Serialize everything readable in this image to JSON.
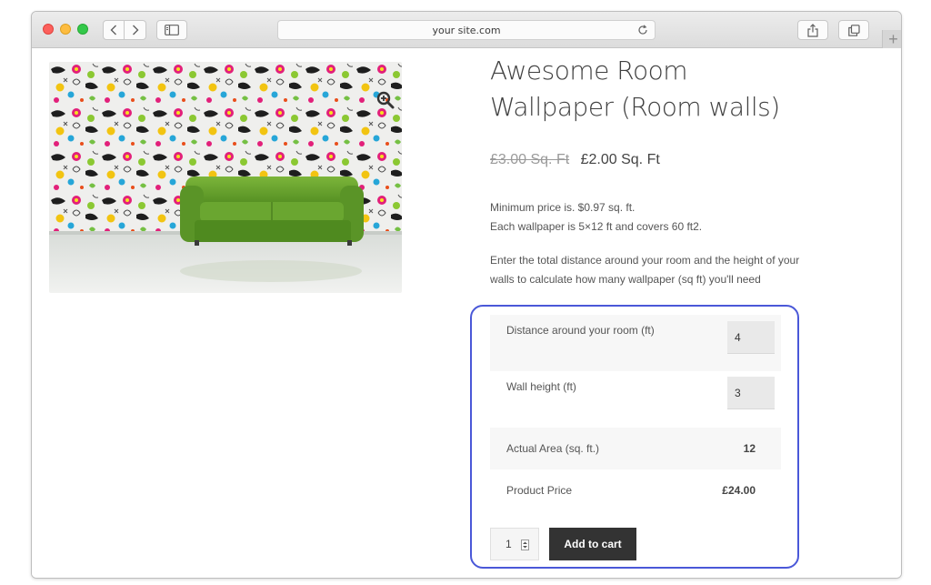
{
  "browser": {
    "address": "your site.com",
    "colors": {
      "close": "#fc605c",
      "minimize": "#fdbc40",
      "zoom": "#34c84a"
    }
  },
  "product": {
    "title": "Awesome Room Wallpaper (Room walls)",
    "old_price": "£3.00 Sq. Ft",
    "new_price": "£2.00 Sq. Ft",
    "min_price_line": "Minimum price is. $0.97 sq. ft.",
    "coverage_line": "Each wallpaper is 5×12 ft and covers 60 ft2.",
    "instructions": "Enter the total distance around your room and the height of your walls to calculate how many wallpaper (sq ft) you'll need",
    "image_icon": "zoom-in-icon"
  },
  "calculator": {
    "distance_label": "Distance around your room (ft)",
    "distance_value": "4",
    "height_label": "Wall height (ft)",
    "height_value": "3",
    "area_label": "Actual Area (sq. ft.)",
    "area_value": "12",
    "price_label": "Product Price",
    "price_value": "£24.00",
    "highlight_color": "#4a58d8"
  },
  "cart": {
    "quantity": "1",
    "add_label": "Add to cart"
  }
}
